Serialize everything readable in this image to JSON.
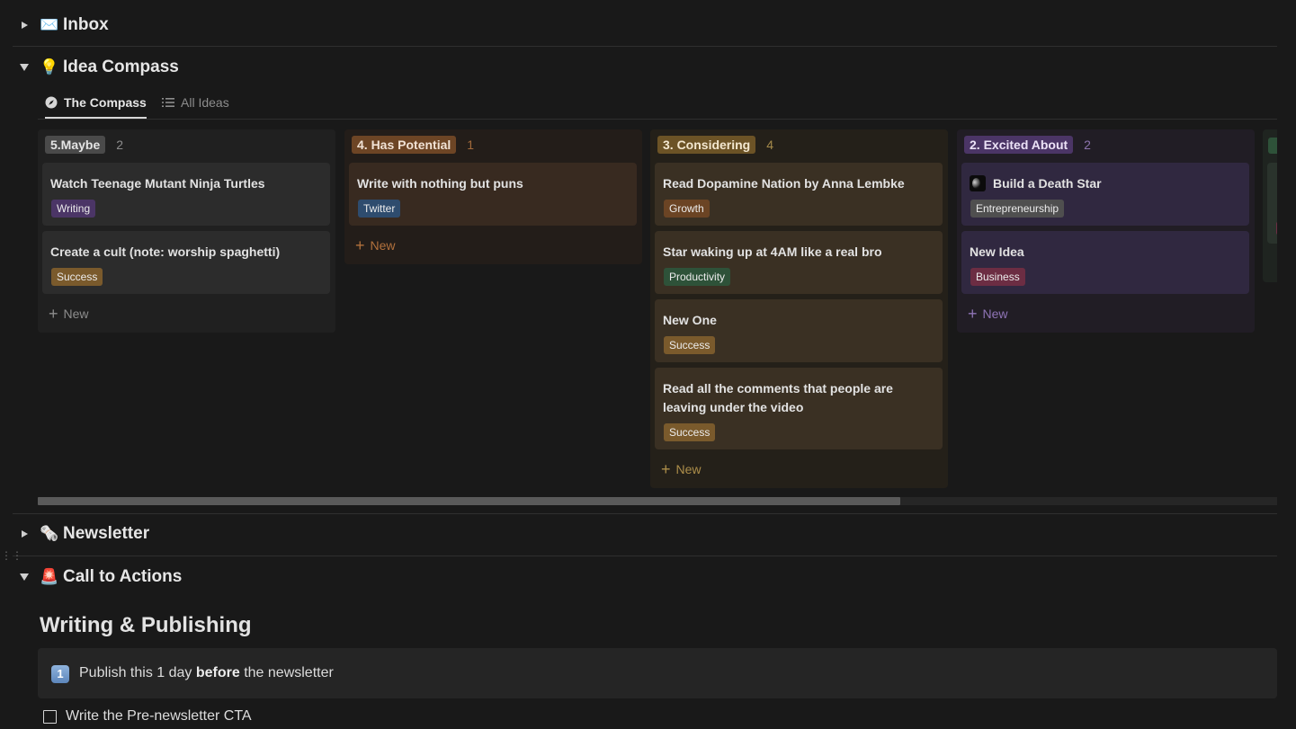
{
  "sections": {
    "inbox": {
      "emoji": "✉️",
      "title": "Inbox",
      "expanded": false
    },
    "idea_compass": {
      "emoji": "💡",
      "title": "Idea Compass",
      "expanded": true
    },
    "newsletter": {
      "emoji": "🗞️",
      "title": "Newsletter",
      "expanded": false
    },
    "call_to_actions": {
      "emoji": "🚨",
      "title": "Call to Actions",
      "expanded": true
    }
  },
  "tabs": [
    {
      "label": "The Compass",
      "icon": "compass-icon",
      "active": true
    },
    {
      "label": "All Ideas",
      "icon": "list-icon",
      "active": false
    }
  ],
  "board": {
    "new_label": "New",
    "columns": [
      {
        "label": "5.Maybe",
        "count": "2",
        "colors": {
          "bg": "#202020",
          "label_bg": "#4a4a4a",
          "label_text": "#e4e4e4",
          "count": "#8d8d8d",
          "card": "#2c2c2c",
          "new": "#8d8d8d"
        },
        "cards": [
          {
            "title": "Watch Teenage Mutant Ninja Turtles",
            "tag": "Writing",
            "tag_color": "#4b3566"
          },
          {
            "title": "Create a cult (note: worship spaghetti)",
            "tag": "Success",
            "tag_color": "#7a5a2c"
          }
        ]
      },
      {
        "label": "4. Has Potential",
        "count": "1",
        "colors": {
          "bg": "#231d19",
          "label_bg": "#6d4525",
          "label_text": "#f1e2d5",
          "count": "#a36a3b",
          "card": "#382a20",
          "new": "#b2713c"
        },
        "cards": [
          {
            "title": "Write with nothing but puns",
            "tag": "Twitter",
            "tag_color": "#2e4c6e"
          }
        ]
      },
      {
        "label": "3. Considering",
        "count": "4",
        "colors": {
          "bg": "#242019",
          "label_bg": "#6c5326",
          "label_text": "#f3e7cf",
          "count": "#a58a4a",
          "card": "#3a3023",
          "new": "#ad8e4a"
        },
        "cards": [
          {
            "title": "Read Dopamine Nation by Anna Lembke",
            "tag": "Growth",
            "tag_color": "#6b4424"
          },
          {
            "title": "Star waking up at 4AM like a real bro",
            "tag": "Productivity",
            "tag_color": "#2e5239"
          },
          {
            "title": "New One",
            "tag": "Success",
            "tag_color": "#7a5a2c"
          },
          {
            "title": "Read all the comments that people are leaving under the video",
            "tag": "Success",
            "tag_color": "#7a5a2c"
          }
        ]
      },
      {
        "label": "2. Excited About",
        "count": "2",
        "colors": {
          "bg": "#211d25",
          "label_bg": "#4b3566",
          "label_text": "#ece2f7",
          "count": "#8c73ad",
          "card": "#302840",
          "new": "#8f74b6"
        },
        "cards": [
          {
            "title": "Build a Death Star",
            "tag": "Entrepreneurship",
            "tag_color": "#4f4f4f",
            "thumb": "death-star-thumbnail"
          },
          {
            "title": "New Idea",
            "tag": "Business",
            "tag_color": "#6c2d43"
          }
        ]
      }
    ]
  },
  "heading": "Writing & Publishing",
  "callout": {
    "icon": "keycap-1-icon",
    "icon_text": "1",
    "text_before": "Publish this 1 day ",
    "text_bold": "before",
    "text_after": " the newsletter"
  },
  "todo": {
    "label": "Write the Pre-newsletter CTA",
    "checked": false
  }
}
